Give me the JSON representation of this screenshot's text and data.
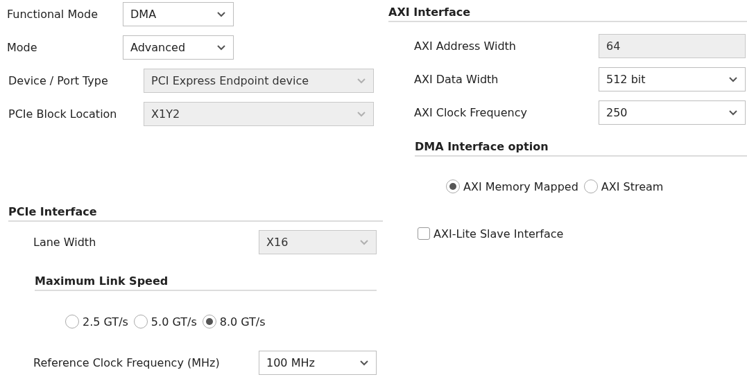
{
  "basic_fields": [
    {
      "label": "Functional Mode",
      "kind": "dropdown",
      "value": "DMA",
      "disabled": false
    },
    {
      "label": "Mode",
      "kind": "dropdown",
      "value": "Advanced",
      "disabled": false
    },
    {
      "label": "Device / Port Type",
      "kind": "dropdown",
      "value": "PCI Express Endpoint device",
      "disabled": true
    },
    {
      "label": "PCIe Block Location",
      "kind": "dropdown",
      "value": "X1Y2",
      "disabled": true
    }
  ],
  "pcie_interface": {
    "title": "PCIe Interface",
    "lane_width": {
      "label": "Lane Width",
      "kind": "dropdown",
      "value": "X16",
      "disabled": true
    },
    "link_speed": {
      "title": "Maximum Link Speed",
      "options": [
        {
          "label": "2.5 GT/s",
          "selected": false
        },
        {
          "label": "5.0 GT/s",
          "selected": false
        },
        {
          "label": "8.0 GT/s",
          "selected": true
        }
      ]
    },
    "ref_clock": {
      "label": "Reference Clock Frequency (MHz)",
      "kind": "dropdown",
      "value": "100 MHz",
      "disabled": false
    }
  },
  "axi_interface": {
    "title": "AXI Interface",
    "fields": [
      {
        "label": "AXI Address Width",
        "kind": "text",
        "value": "64",
        "disabled": true
      },
      {
        "label": "AXI Data Width",
        "kind": "dropdown",
        "value": "512 bit",
        "disabled": false
      },
      {
        "label": "AXI Clock Frequency",
        "kind": "dropdown",
        "value": "250",
        "disabled": false
      }
    ]
  },
  "dma_interface": {
    "title": "DMA Interface option",
    "options": [
      {
        "label": "AXI Memory Mapped",
        "selected": true
      },
      {
        "label": "AXI Stream",
        "selected": false
      }
    ]
  },
  "axi_lite": {
    "label": "AXI-Lite Slave Interface",
    "checked": false
  }
}
